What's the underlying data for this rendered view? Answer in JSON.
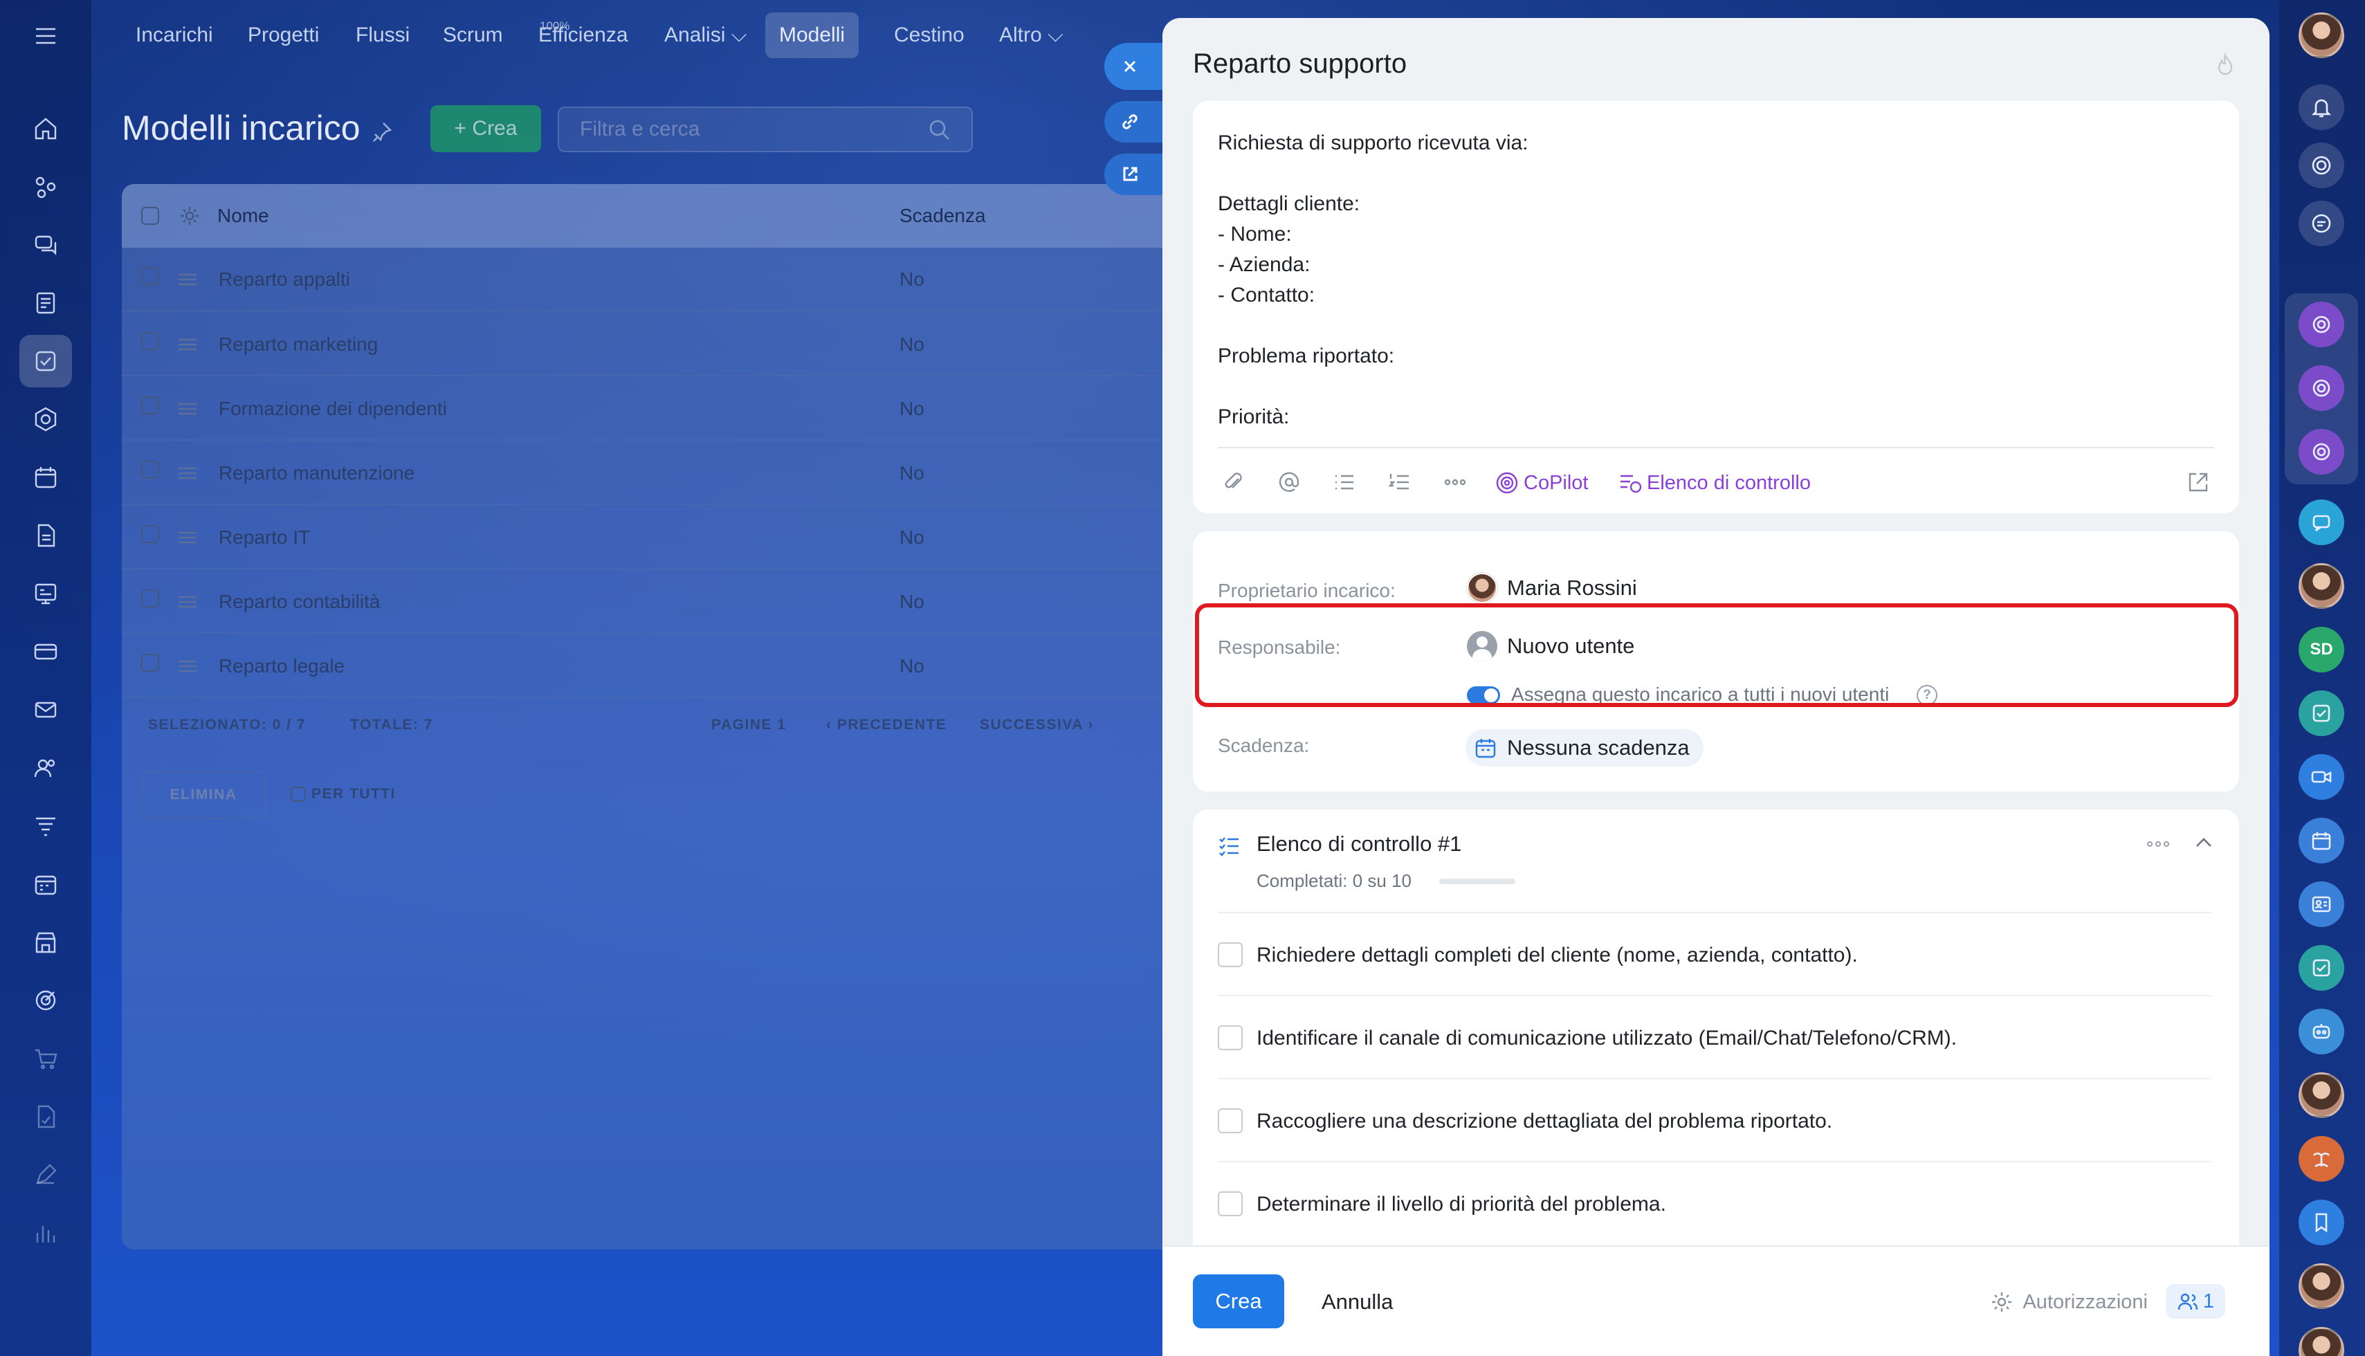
{
  "nav": {
    "items": [
      {
        "label": "Incarichi"
      },
      {
        "label": "Progetti"
      },
      {
        "label": "Flussi"
      },
      {
        "label": "Scrum"
      },
      {
        "label": "Efficienza",
        "badge": "100%"
      },
      {
        "label": "Analisi ⌵"
      },
      {
        "label": "Modelli"
      },
      {
        "label": "Cestino"
      },
      {
        "label": "Altro ⌵"
      }
    ]
  },
  "page": {
    "title": "Modelli incarico",
    "create_label": "+ Crea",
    "search_placeholder": "Filtra e cerca"
  },
  "table": {
    "col_name": "Nome",
    "col_due": "Scadenza",
    "rows": [
      {
        "name": "Reparto appalti",
        "due": "No"
      },
      {
        "name": "Reparto marketing",
        "due": "No"
      },
      {
        "name": "Formazione dei dipendenti",
        "due": "No"
      },
      {
        "name": "Reparto manutenzione",
        "due": "No"
      },
      {
        "name": "Reparto IT",
        "due": "No"
      },
      {
        "name": "Reparto contabilità",
        "due": "No"
      },
      {
        "name": "Reparto legale",
        "due": "No"
      }
    ],
    "selected": "SELEZIONATO: 0 / 7",
    "total": "TOTALE: 7",
    "pages": "PAGINE  1",
    "prev": "‹  PRECEDENTE",
    "next": "SUCCESSIVA  ›",
    "delete_label": "ELIMINA",
    "for_all_label": "PER TUTTI"
  },
  "task": {
    "title": "Reparto supporto",
    "description": [
      "Richiesta di supporto ricevuta via:",
      "Dettagli cliente:",
      "- Nome:",
      "- Azienda:",
      "- Contatto:",
      "Problema riportato:",
      "Priorità:"
    ],
    "copilot_label": "CoPilot",
    "checklist_label": "Elenco di controllo",
    "owner_label": "Proprietario incarico:",
    "owner_name": "Maria Rossini",
    "responsible_label": "Responsabile:",
    "responsible_name": "Nuovo utente",
    "assign_all_label": "Assegna questo incarico a tutti i nuovi utenti",
    "assign_all_enabled": true,
    "due_label": "Scadenza:",
    "due_value": "Nessuna scadenza",
    "checklist": {
      "title": "Elenco di controllo #1",
      "progress": "Completati: 0 su 10",
      "completed": 0,
      "total": 10,
      "items": [
        "Richiedere dettagli completi del cliente (nome, azienda, contatto).",
        "Identificare il canale di comunicazione utilizzato (Email/Chat/Telefono/CRM).",
        "Raccogliere una descrizione dettagliata del problema riportato.",
        "Determinare il livello di priorità del problema."
      ]
    },
    "footer": {
      "create_label": "Crea",
      "cancel_label": "Annulla",
      "permissions_label": "Autorizzazioni",
      "permissions_count": "1"
    }
  },
  "rightbar": {
    "sd_label": "SD"
  },
  "colors": {
    "accent": "#1f7ae8",
    "copilot": "#8b3fd9",
    "highlight": "#e0191e",
    "create_green": "#1f9f63"
  }
}
